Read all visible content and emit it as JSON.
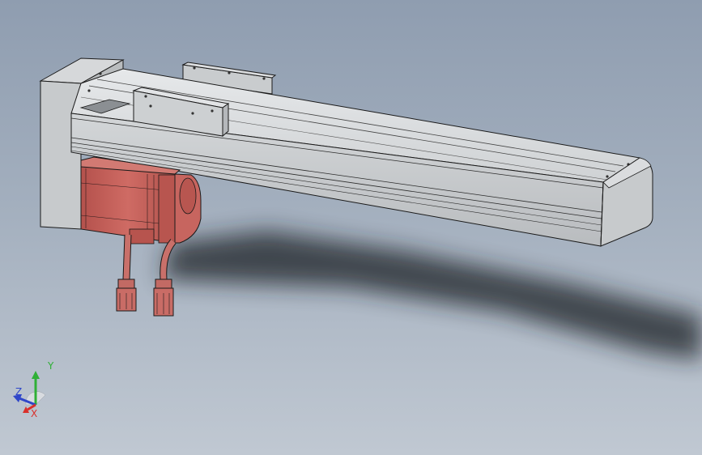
{
  "viewport": {
    "background_top": "#8f9db0",
    "background_bottom": "#c0c8d2"
  },
  "model": {
    "name": "linear-actuator-with-servo-motor",
    "body_color": "#cfd2d4",
    "motor_color": "#c4625c",
    "edge_color": "#1a1a1a"
  },
  "triad": {
    "x_label": "X",
    "y_label": "Y",
    "z_label": "Z",
    "x_color": "#d9302b",
    "y_color": "#2fb036",
    "z_color": "#2f46c9"
  }
}
